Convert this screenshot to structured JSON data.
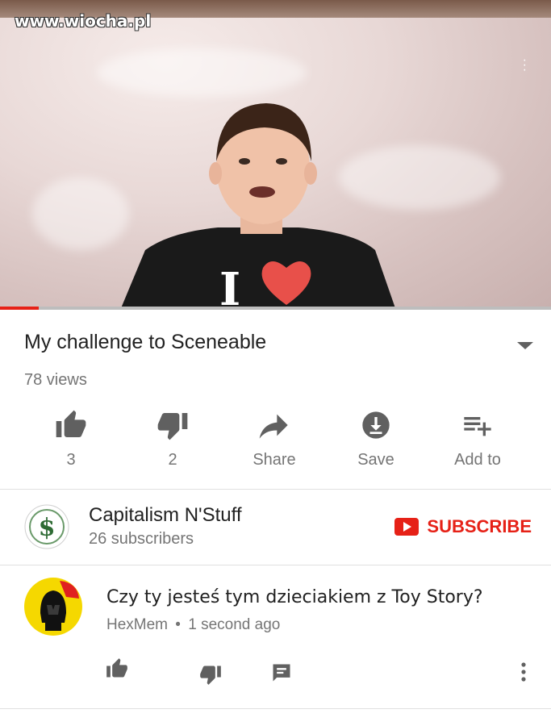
{
  "watermark": "www.wiocha.pl",
  "video": {
    "title": "My challenge to Sceneable",
    "views": "78 views",
    "progress_fraction": 0.07,
    "shirt_letter": "I"
  },
  "actions": [
    {
      "icon": "thumbs-up-icon",
      "label": "3"
    },
    {
      "icon": "thumbs-down-icon",
      "label": "2"
    },
    {
      "icon": "share-icon",
      "label": "Share"
    },
    {
      "icon": "download-icon",
      "label": "Save"
    },
    {
      "icon": "add-to-playlist-icon",
      "label": "Add to"
    }
  ],
  "channel": {
    "name": "Capitalism N'Stuff",
    "subscribers": "26 subscribers",
    "avatar_glyph": "$",
    "subscribe_label": "SUBSCRIBE"
  },
  "comment": {
    "text": "Czy ty jesteś tym dzieciakiem z Toy Story?",
    "author": "HexMem",
    "separator": "•",
    "time": "1 second ago"
  },
  "colors": {
    "accent_red": "#e62117",
    "secondary_text": "#757575",
    "icon_gray": "#606060"
  }
}
